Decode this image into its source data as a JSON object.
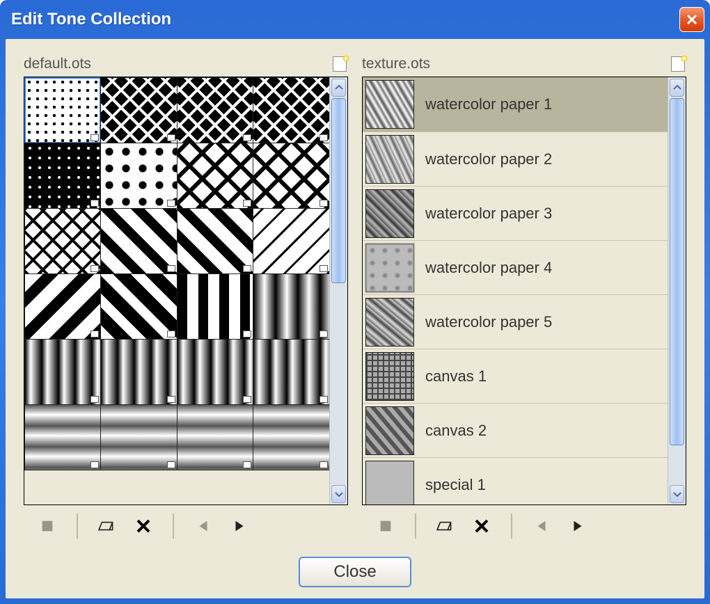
{
  "window": {
    "title": "Edit Tone Collection"
  },
  "panels": {
    "left": {
      "filename": "default.ots"
    },
    "right": {
      "filename": "texture.ots"
    }
  },
  "left_swatches": [
    {
      "pattern": "p-dot-w",
      "selected": true
    },
    {
      "pattern": "p-cross-b",
      "selected": false
    },
    {
      "pattern": "p-cross-b",
      "selected": false
    },
    {
      "pattern": "p-cross-b",
      "selected": false
    },
    {
      "pattern": "p-dot-b",
      "selected": false
    },
    {
      "pattern": "p-dot-w-big",
      "selected": false
    },
    {
      "pattern": "p-diamond-w",
      "selected": false
    },
    {
      "pattern": "p-diamond-w",
      "selected": false
    },
    {
      "pattern": "p-cross-w",
      "selected": false
    },
    {
      "pattern": "p-diag-w",
      "selected": false
    },
    {
      "pattern": "p-diag-w",
      "selected": false
    },
    {
      "pattern": "p-diag-thin",
      "selected": false
    },
    {
      "pattern": "p-diag-r",
      "selected": false
    },
    {
      "pattern": "p-diag-b",
      "selected": false
    },
    {
      "pattern": "p-vert-w",
      "selected": false
    },
    {
      "pattern": "p-vert-grad2",
      "selected": false
    },
    {
      "pattern": "p-vert-grad",
      "selected": false
    },
    {
      "pattern": "p-vert-grad",
      "selected": false
    },
    {
      "pattern": "p-vert-grad",
      "selected": false
    },
    {
      "pattern": "p-vert-grad",
      "selected": false
    },
    {
      "pattern": "p-horz-grad",
      "selected": false
    },
    {
      "pattern": "p-horz-grad",
      "selected": false
    },
    {
      "pattern": "p-horz-grad",
      "selected": false
    },
    {
      "pattern": "p-horz-grad",
      "selected": false
    }
  ],
  "right_rows": [
    {
      "label": "watercolor paper 1",
      "thumb": "tx1",
      "selected": true
    },
    {
      "label": "watercolor paper 2",
      "thumb": "tx2",
      "selected": false
    },
    {
      "label": "watercolor paper 3",
      "thumb": "tx3",
      "selected": false
    },
    {
      "label": "watercolor paper 4",
      "thumb": "tx4",
      "selected": false
    },
    {
      "label": "watercolor paper 5",
      "thumb": "tx5",
      "selected": false
    },
    {
      "label": "canvas 1",
      "thumb": "tx6",
      "selected": false
    },
    {
      "label": "canvas 2",
      "thumb": "tx7",
      "selected": false
    },
    {
      "label": "special 1",
      "thumb": "tx8",
      "selected": false
    }
  ],
  "left_scroll": {
    "thumb_top": 0,
    "thumb_height": 48
  },
  "right_scroll": {
    "thumb_top": 0,
    "thumb_height": 90
  },
  "buttons": {
    "close": "Close"
  }
}
